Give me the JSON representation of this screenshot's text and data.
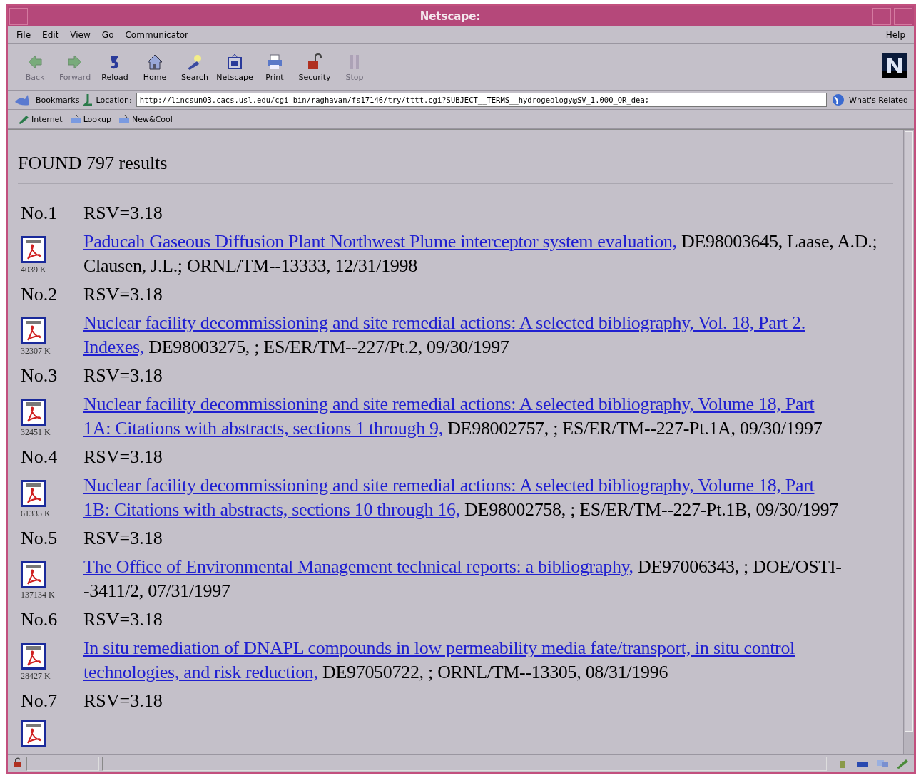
{
  "window": {
    "title": "Netscape:"
  },
  "menu": {
    "left": [
      "File",
      "Edit",
      "View",
      "Go",
      "Communicator"
    ],
    "right": "Help"
  },
  "toolbar": [
    {
      "label": "Back",
      "kind": "back",
      "disabled": true
    },
    {
      "label": "Forward",
      "kind": "forward",
      "disabled": true
    },
    {
      "label": "Reload",
      "kind": "reload",
      "disabled": false
    },
    {
      "label": "Home",
      "kind": "home",
      "disabled": false
    },
    {
      "label": "Search",
      "kind": "search",
      "disabled": false
    },
    {
      "label": "Netscape",
      "kind": "netscape",
      "disabled": false
    },
    {
      "label": "Print",
      "kind": "print",
      "disabled": false
    },
    {
      "label": "Security",
      "kind": "security",
      "disabled": false
    },
    {
      "label": "Stop",
      "kind": "stop",
      "disabled": true
    }
  ],
  "location_bar": {
    "bookmarks": "Bookmarks",
    "location_label": "Location:",
    "url": "http://lincsun03.cacs.usl.edu/cgi-bin/raghavan/fs17146/try/tttt.cgi?SUBJECT__TERMS__hydrogeology@SV_1.000_OR_dea;",
    "related": "What's Related"
  },
  "personal_toolbar": [
    "Internet",
    "Lookup",
    "New&Cool"
  ],
  "page": {
    "summary": "FOUND 797 results",
    "results": [
      {
        "no": "No.1",
        "rsv": "RSV=3.18",
        "size": "4039 K",
        "title": [
          "Paducah Gaseous Diffusion Plant Northwest Plume interceptor system evaluation,"
        ],
        "details": " DE98003645, Laase, A.D.; Clausen, J.L.; ORNL/TM--13333, 12/31/1998"
      },
      {
        "no": "No.2",
        "rsv": "RSV=3.18",
        "size": "32307 K",
        "title": [
          "Nuclear facility decommissioning and site remedial actions: A selected bibliography, Vol. 18, Part 2.",
          "Indexes,"
        ],
        "details": " DE98003275, ; ES/ER/TM--227/Pt.2, 09/30/1997"
      },
      {
        "no": "No.3",
        "rsv": "RSV=3.18",
        "size": "32451 K",
        "title": [
          "Nuclear facility decommissioning and site remedial actions: A selected bibliography, Volume 18, Part",
          "1A: Citations with abstracts, sections 1 through 9,"
        ],
        "details": " DE98002757, ; ES/ER/TM--227-Pt.1A, 09/30/1997"
      },
      {
        "no": "No.4",
        "rsv": "RSV=3.18",
        "size": "61335 K",
        "title": [
          "Nuclear facility decommissioning and site remedial actions: A selected bibliography, Volume 18, Part",
          "1B: Citations with abstracts, sections 10 through 16,"
        ],
        "details": " DE98002758, ; ES/ER/TM--227-Pt.1B, 09/30/1997"
      },
      {
        "no": "No.5",
        "rsv": "RSV=3.18",
        "size": "137134 K",
        "title": [
          "The Office of Environmental Management technical reports: a bibliography,"
        ],
        "details": " DE97006343, ; DOE/OSTI--3411/2, 07/31/1997"
      },
      {
        "no": "No.6",
        "rsv": "RSV=3.18",
        "size": "28427 K",
        "title": [
          "In situ remediation of DNAPL compounds in low permeability media fate/transport, in situ control",
          "technologies, and risk reduction,"
        ],
        "details": " DE97050722, ; ORNL/TM--13305, 08/31/1996"
      },
      {
        "no": "No.7",
        "rsv": "RSV=3.18"
      }
    ]
  }
}
